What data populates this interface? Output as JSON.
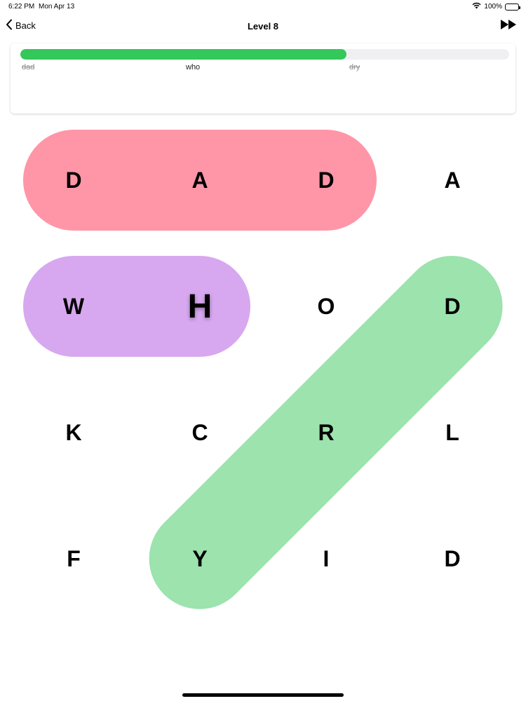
{
  "status_bar": {
    "time": "6:22 PM",
    "date": "Mon Apr 13",
    "battery": "100%"
  },
  "nav": {
    "back_label": "Back",
    "title": "Level 8",
    "skip_icon": "fast-forward-icon"
  },
  "progress": {
    "fraction": 0.667,
    "color": "#34c759",
    "words": [
      {
        "text": "dad",
        "found": true
      },
      {
        "text": "who",
        "found": false
      },
      {
        "text": "dry",
        "found": true
      }
    ]
  },
  "grid": {
    "rows": [
      [
        "D",
        "A",
        "D",
        "A"
      ],
      [
        "W",
        "H",
        "O",
        "D"
      ],
      [
        "K",
        "C",
        "R",
        "L"
      ],
      [
        "F",
        "Y",
        "I",
        "D"
      ]
    ],
    "active_cell": [
      1,
      1
    ]
  },
  "highlights": [
    {
      "word": "dad",
      "color": "#fe96a7",
      "from": [
        0,
        0
      ],
      "to": [
        0,
        2
      ]
    },
    {
      "word": "who",
      "color": "#d7a8ef",
      "from": [
        1,
        0
      ],
      "to": [
        1,
        1
      ]
    },
    {
      "word": "dry",
      "color": "#9ce3ad",
      "from": [
        1,
        3
      ],
      "to": [
        3,
        1
      ]
    }
  ]
}
